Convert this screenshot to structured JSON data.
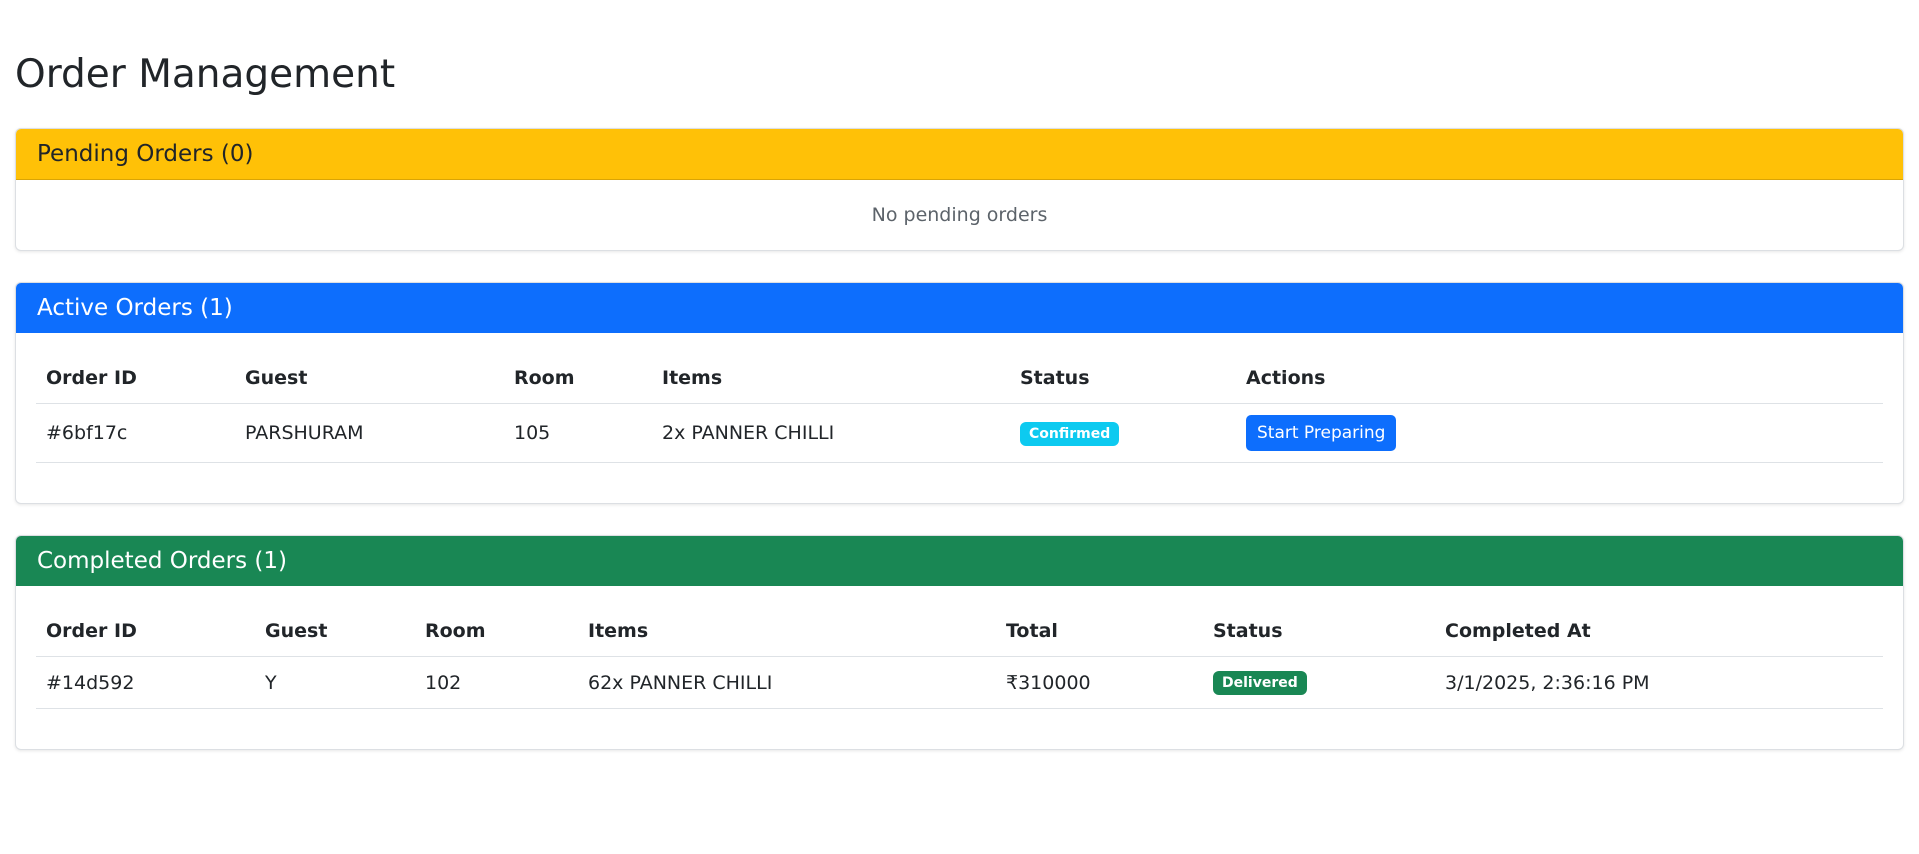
{
  "page": {
    "title": "Order Management"
  },
  "pending": {
    "header": "Pending Orders (0)",
    "empty_text": "No pending orders",
    "header_color": "#ffc107"
  },
  "active": {
    "header": "Active Orders (1)",
    "header_color": "#0d6efd",
    "columns": [
      "Order ID",
      "Guest",
      "Room",
      "Items",
      "Status",
      "Actions"
    ],
    "rows": [
      {
        "order_id": "#6bf17c",
        "guest": "PARSHURAM",
        "room": "105",
        "items": "2x PANNER CHILLI",
        "status": "Confirmed",
        "status_color": "#0dcaf0",
        "action": "Start Preparing"
      }
    ]
  },
  "completed": {
    "header": "Completed Orders (1)",
    "header_color": "#198754",
    "columns": [
      "Order ID",
      "Guest",
      "Room",
      "Items",
      "Total",
      "Status",
      "Completed At"
    ],
    "rows": [
      {
        "order_id": "#14d592",
        "guest": "Y",
        "room": "102",
        "items": "62x PANNER CHILLI",
        "total": "₹310000",
        "status": "Delivered",
        "status_color": "#198754",
        "completed_at": "3/1/2025, 2:36:16 PM"
      }
    ]
  }
}
